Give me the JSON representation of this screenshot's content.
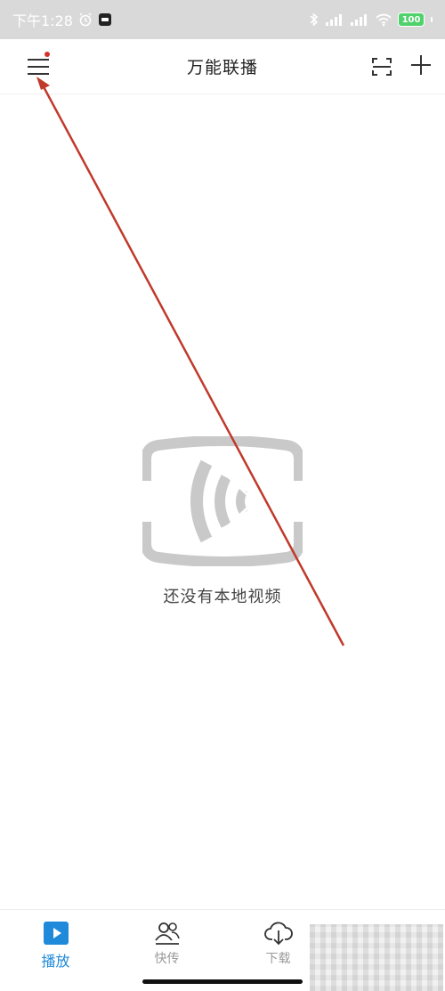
{
  "status_bar": {
    "time": "下午1:28",
    "battery": "100"
  },
  "header": {
    "title": "万能联播"
  },
  "empty_state": {
    "message": "还没有本地视频"
  },
  "bottom_nav": {
    "items": [
      {
        "label": "播放",
        "icon": "play-icon",
        "active": true
      },
      {
        "label": "快传",
        "icon": "users-icon",
        "active": false
      },
      {
        "label": "下载",
        "icon": "cloud-download-icon",
        "active": false
      }
    ]
  },
  "colors": {
    "accent": "#1f8ad9",
    "annotation_red": "#c0392b",
    "status_bar_bg": "#d9d9d9",
    "empty_icon_gray": "#c9c9c9"
  }
}
